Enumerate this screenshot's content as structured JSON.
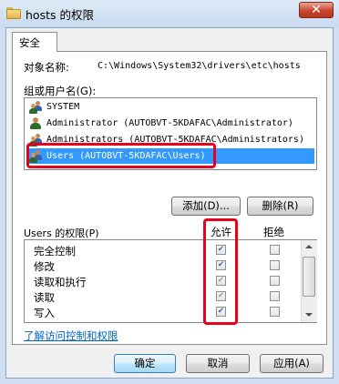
{
  "window": {
    "title": "hosts 的权限",
    "close_label": "✕"
  },
  "tabs": [
    {
      "label": "安全"
    }
  ],
  "object": {
    "label": "对象名称:",
    "path": "C:\\Windows\\System32\\drivers\\etc\\hosts"
  },
  "users": {
    "label": "组或用户名(G):",
    "items": [
      {
        "name": "SYSTEM",
        "icon": "user-group-icon"
      },
      {
        "name": "Administrator (AUTOBVT-5KDAFAC\\Administrator)",
        "icon": "user-icon"
      },
      {
        "name": "Administrators (AUTOBVT-5KDAFAC\\Administrators)",
        "icon": "user-group-icon"
      },
      {
        "name": "Users (AUTOBVT-5KDAFAC\\Users)",
        "icon": "user-group-icon",
        "selected": true
      }
    ],
    "add_label": "添加(D)...",
    "remove_label": "删除(R)"
  },
  "permissions": {
    "label": "Users 的权限(P)",
    "allow_label": "允许",
    "deny_label": "拒绝",
    "rows": [
      {
        "name": "完全控制",
        "allow": true,
        "allow_inherited": false,
        "deny": false
      },
      {
        "name": "修改",
        "allow": true,
        "allow_inherited": false,
        "deny": false
      },
      {
        "name": "读取和执行",
        "allow": true,
        "allow_inherited": true,
        "deny": false
      },
      {
        "name": "读取",
        "allow": true,
        "allow_inherited": true,
        "deny": false
      },
      {
        "name": "写入",
        "allow": true,
        "allow_inherited": false,
        "deny": false
      }
    ]
  },
  "link": {
    "text": "了解访问控制和权限"
  },
  "footer": {
    "ok": "确定",
    "cancel": "取消",
    "apply": "应用(A)"
  },
  "colors": {
    "selection": "#3399ff",
    "highlight": "#e8001c",
    "link": "#0066cc"
  }
}
